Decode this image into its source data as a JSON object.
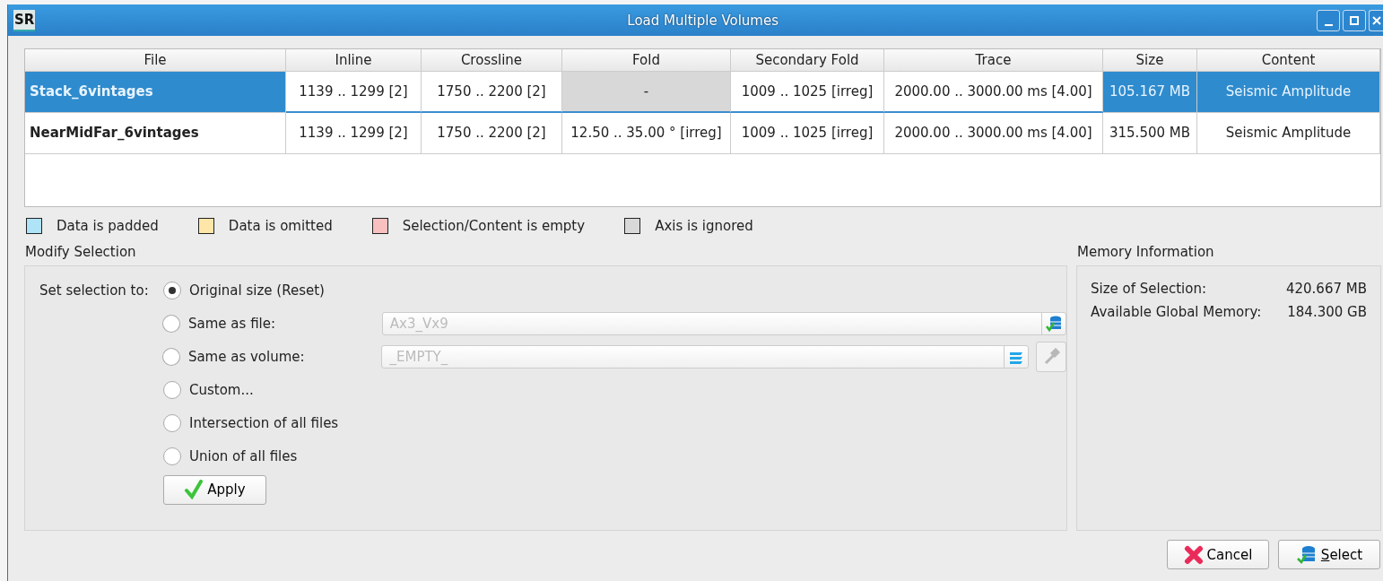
{
  "window": {
    "title": "Load Multiple Volumes",
    "logo": "SR"
  },
  "table": {
    "columns": [
      {
        "label": "File",
        "kind": "name"
      },
      {
        "label": "Inline",
        "kind": "range"
      },
      {
        "label": "Crossline",
        "kind": "range"
      },
      {
        "label": "Fold",
        "kind": "range"
      },
      {
        "label": "Secondary Fold",
        "kind": "range"
      },
      {
        "label": "Trace",
        "kind": "range"
      },
      {
        "label": "Size",
        "kind": "info"
      },
      {
        "label": "Content",
        "kind": "info"
      }
    ],
    "rows": [
      {
        "selected": true,
        "cells": [
          {
            "text": "Stack_6vintages",
            "ignored": false
          },
          {
            "text": "1139 .. 1299  [2]",
            "ignored": false
          },
          {
            "text": "1750 .. 2200  [2]",
            "ignored": false
          },
          {
            "text": "-",
            "ignored": true
          },
          {
            "text": "1009 .. 1025  [irreg]",
            "ignored": false
          },
          {
            "text": "2000.00 .. 3000.00 ms [4.00]",
            "ignored": false
          },
          {
            "text": "105.167 MB",
            "ignored": false
          },
          {
            "text": "Seismic Amplitude",
            "ignored": false
          }
        ]
      },
      {
        "selected": false,
        "cells": [
          {
            "text": "NearMidFar_6vintages",
            "ignored": false
          },
          {
            "text": "1139 .. 1299  [2]",
            "ignored": false
          },
          {
            "text": "1750 .. 2200  [2]",
            "ignored": false
          },
          {
            "text": "12.50 .. 35.00 ° [irreg]",
            "ignored": false
          },
          {
            "text": "1009 .. 1025  [irreg]",
            "ignored": false
          },
          {
            "text": "2000.00 .. 3000.00 ms [4.00]",
            "ignored": false
          },
          {
            "text": "315.500 MB",
            "ignored": false
          },
          {
            "text": "Seismic Amplitude",
            "ignored": false
          }
        ]
      }
    ]
  },
  "legend": [
    {
      "label": "Data is padded",
      "color": "#aee3f8"
    },
    {
      "label": "Data is omitted",
      "color": "#fde6a8"
    },
    {
      "label": "Selection/Content is empty",
      "color": "#f9c0c0"
    },
    {
      "label": "Axis is ignored",
      "color": "#d8d8d8"
    }
  ],
  "modify_selection": {
    "title": "Modify Selection",
    "prompt": "Set selection to:",
    "options": [
      {
        "label": "Original size (Reset)",
        "selected": true,
        "kind": "plain"
      },
      {
        "label": "Same as file:",
        "selected": false,
        "kind": "file",
        "field": {
          "placeholder": "Ax3_Vx9",
          "disabled": true
        }
      },
      {
        "label": "Same as volume:",
        "selected": false,
        "kind": "volume",
        "field": {
          "placeholder": "_EMPTY_",
          "disabled": true
        }
      },
      {
        "label": "Custom...",
        "selected": false,
        "kind": "plain"
      },
      {
        "label": "Intersection of all files",
        "selected": false,
        "kind": "plain"
      },
      {
        "label": "Union of all files",
        "selected": false,
        "kind": "plain"
      }
    ],
    "apply": "Apply"
  },
  "memory": {
    "title": "Memory Information",
    "rows": [
      {
        "label": "Size of Selection:",
        "value": "420.667 MB"
      },
      {
        "label": "Available Global Memory:",
        "value": "184.300 GB"
      }
    ]
  },
  "buttons": [
    {
      "label": "Cancel",
      "kind": "cancel"
    },
    {
      "label": "Select",
      "kind": "select"
    }
  ]
}
